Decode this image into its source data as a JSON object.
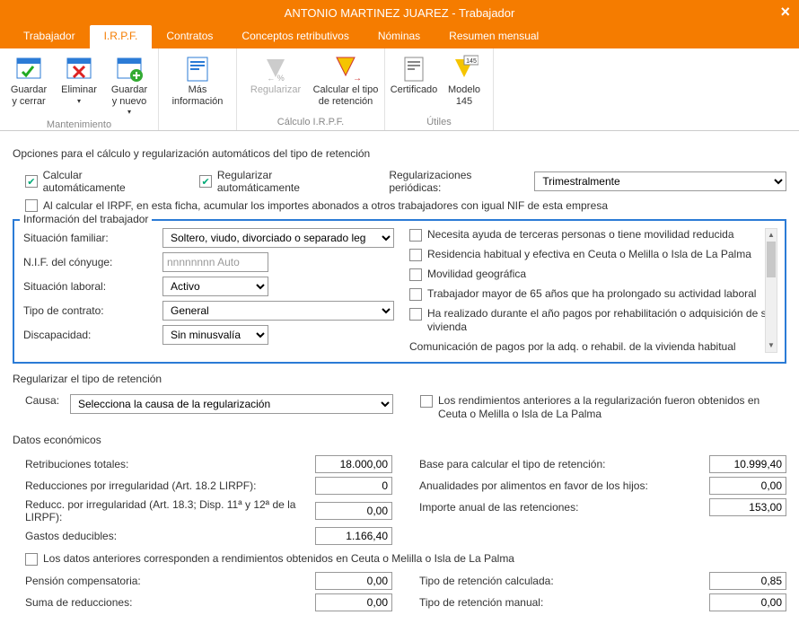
{
  "window": {
    "title": "ANTONIO MARTINEZ JUAREZ - Trabajador"
  },
  "tabs": [
    {
      "label": "Trabajador"
    },
    {
      "label": "I.R.P.F."
    },
    {
      "label": "Contratos"
    },
    {
      "label": "Conceptos retributivos"
    },
    {
      "label": "Nóminas"
    },
    {
      "label": "Resumen mensual"
    }
  ],
  "ribbon": {
    "groups": [
      {
        "label": "Mantenimiento",
        "buttons": [
          {
            "label1": "Guardar",
            "label2": "y cerrar"
          },
          {
            "label1": "Eliminar",
            "label2": ""
          },
          {
            "label1": "Guardar",
            "label2": "y nuevo"
          }
        ]
      },
      {
        "label": "",
        "buttons": [
          {
            "label1": "Más",
            "label2": "información"
          }
        ]
      },
      {
        "label": "Cálculo I.R.P.F.",
        "buttons": [
          {
            "label1": "Regularizar",
            "label2": ""
          },
          {
            "label1": "Calcular el tipo",
            "label2": "de retención"
          }
        ]
      },
      {
        "label": "Útiles",
        "buttons": [
          {
            "label1": "Certificado",
            "label2": ""
          },
          {
            "label1": "Modelo",
            "label2": "145"
          }
        ]
      }
    ]
  },
  "section1_title": "Opciones para el cálculo y regularización automáticos del tipo de retención",
  "opts": {
    "calc_auto": "Calcular automáticamente",
    "reg_auto": "Regularizar automáticamente",
    "reg_period_label": "Regularizaciones periódicas:",
    "reg_period_value": "Trimestralmente",
    "acumular": "Al calcular el IRPF, en esta ficha, acumular los importes abonados a otros trabajadores con igual NIF de esta empresa"
  },
  "groupbox_title": "Información del trabajador",
  "worker": {
    "sit_fam_label": "Situación familiar:",
    "sit_fam_value": "Soltero, viudo, divorciado o separado legalmen",
    "nif_label": "N.I.F. del cónyuge:",
    "nif_value": "nnnnnnnn Auto",
    "sit_lab_label": "Situación laboral:",
    "sit_lab_value": "Activo",
    "tipo_contr_label": "Tipo de contrato:",
    "tipo_contr_value": "General",
    "disc_label": "Discapacidad:",
    "disc_value": "Sin minusvalía"
  },
  "right_checks": [
    "Necesita ayuda de terceras personas o tiene movilidad reducida",
    "Residencia habitual y efectiva en Ceuta o Melilla o Isla de La Palma",
    "Movilidad geográfica",
    "Trabajador mayor de 65 años que ha prolongado su actividad laboral",
    "Ha realizado durante el año pagos por rehabilitación o adquisición de su vivienda"
  ],
  "right_footer": "Comunicación de pagos por la adq. o rehabil. de la vivienda habitual",
  "regularize": {
    "title": "Regularizar el tipo de retención",
    "causa_label": "Causa:",
    "causa_value": "Selecciona la causa de la regularización",
    "ceuta_check": "Los rendimientos anteriores a la regularización fueron obtenidos en Ceuta o Melilla o Isla de La Palma"
  },
  "econ_title": "Datos económicos",
  "econ_left": [
    {
      "label": "Retribuciones totales:",
      "value": "18.000,00"
    },
    {
      "label": "Reducciones por irregularidad (Art. 18.2 LIRPF):",
      "value": "0"
    },
    {
      "label": "Reducc. por irregularidad (Art. 18.3; Disp. 11ª y 12ª de la LIRPF):",
      "value": "0,00"
    },
    {
      "label": "Gastos deducibles:",
      "value": "1.166,40"
    }
  ],
  "econ_ceuta": "Los datos anteriores corresponden a rendimientos obtenidos en Ceuta o Melilla o Isla de La Palma",
  "econ_left2": [
    {
      "label": "Pensión compensatoria:",
      "value": "0,00"
    },
    {
      "label": "Suma de reducciones:",
      "value": "0,00"
    }
  ],
  "econ_right": [
    {
      "label": "Base para calcular el tipo de retención:",
      "value": "10.999,40"
    },
    {
      "label": "Anualidades por alimentos en favor de los hijos:",
      "value": "0,00"
    },
    {
      "label": "Importe anual de las retenciones:",
      "value": "153,00"
    }
  ],
  "econ_right2": [
    {
      "label": "Tipo de retención calculada:",
      "value": "0,85"
    },
    {
      "label": "Tipo de retención manual:",
      "value": "0,00"
    }
  ]
}
